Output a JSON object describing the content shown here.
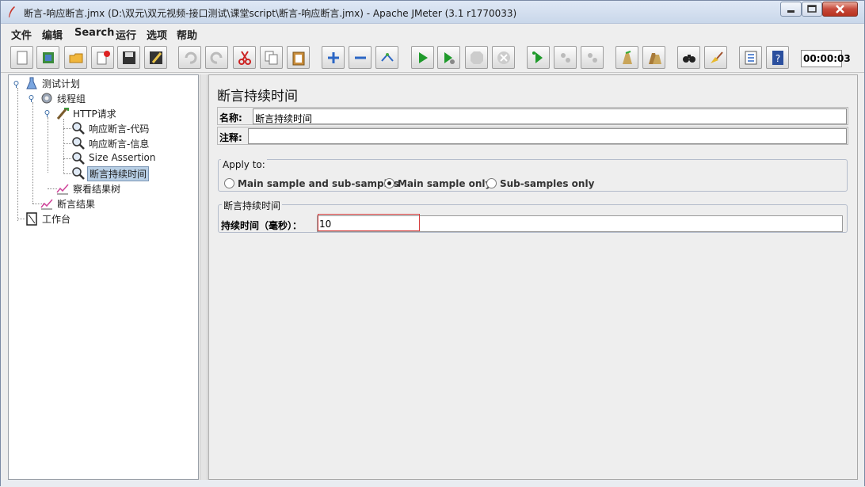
{
  "window": {
    "title": "断言-响应断言.jmx (D:\\双元\\双元视频-接口测试\\课堂script\\断言-响应断言.jmx) - Apache JMeter (3.1 r1770033)"
  },
  "menubar": {
    "items": [
      "文件",
      "编辑",
      "Search",
      "运行",
      "选项",
      "帮助"
    ]
  },
  "toolbar": {
    "buttons": [
      "new-icon",
      "templates-icon",
      "open-icon",
      "close-file-icon",
      "save-icon",
      "save-as-icon",
      "undo-icon",
      "redo-icon",
      "cut-icon",
      "copy-icon",
      "paste-icon",
      "expand-icon",
      "collapse-icon",
      "toggle-icon",
      "start-icon",
      "start-no-pause-icon",
      "stop-icon",
      "shutdown-icon",
      "remote-start-icon",
      "remote-stop-icon",
      "remote-shutdown-icon",
      "clear-icon",
      "clear-all-icon",
      "search-icon",
      "reset-search-icon",
      "function-helper-icon",
      "help-icon"
    ],
    "timer": "00:00:03"
  },
  "tree": {
    "nodes": [
      {
        "label": "测试计划",
        "icon": "test-plan-icon"
      },
      {
        "label": "线程组",
        "icon": "thread-group-icon"
      },
      {
        "label": "HTTP请求",
        "icon": "http-sampler-icon"
      },
      {
        "label": "响应断言-代码",
        "icon": "assertion-icon"
      },
      {
        "label": "响应断言-信息",
        "icon": "assertion-icon"
      },
      {
        "label": "Size Assertion",
        "icon": "assertion-icon"
      },
      {
        "label": "断言持续时间",
        "icon": "assertion-icon",
        "selected": true
      },
      {
        "label": "察看结果树",
        "icon": "listener-icon"
      },
      {
        "label": "断言结果",
        "icon": "listener-icon"
      },
      {
        "label": "工作台",
        "icon": "workbench-icon"
      }
    ]
  },
  "panel": {
    "title": "断言持续时间",
    "name_label": "名称:",
    "name_value": "断言持续时间",
    "comment_label": "注释:",
    "comment_value": "",
    "apply_to": {
      "title": "Apply to:",
      "options": [
        "Main sample and sub-samples",
        "Main sample only",
        "Sub-samples only"
      ],
      "selected": "Main sample only"
    },
    "duration": {
      "title": "断言持续时间",
      "label": "持续时间（毫秒）：",
      "value": "10"
    }
  },
  "colors": {
    "highlight_border": "#d63f3f",
    "selection": "#b8cfe5"
  }
}
